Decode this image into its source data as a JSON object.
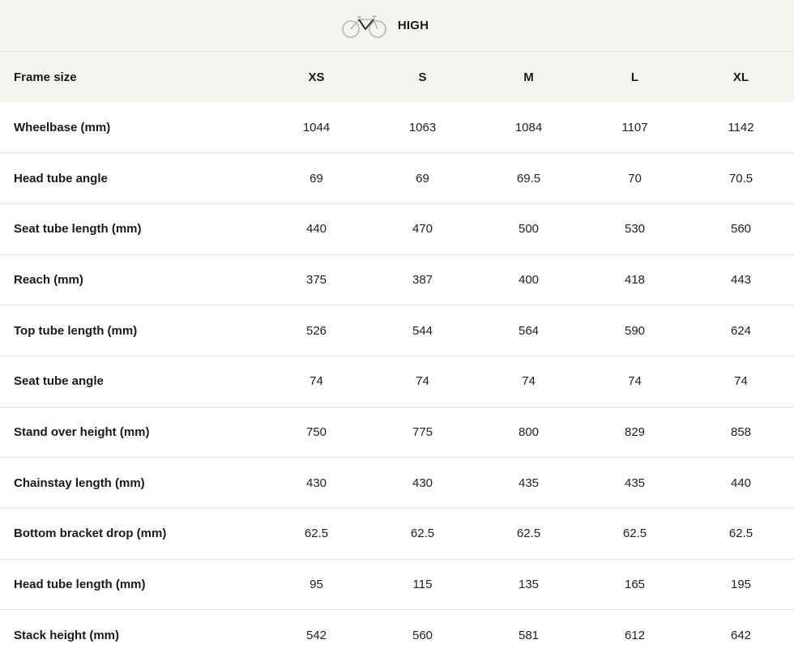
{
  "header": {
    "variant_label": "HIGH",
    "icon": "road-bike-icon"
  },
  "table": {
    "columns": {
      "label": "Frame size",
      "sizes": [
        "XS",
        "S",
        "M",
        "L",
        "XL"
      ]
    },
    "rows": [
      {
        "label": "Wheelbase (mm)",
        "values": [
          "1044",
          "1063",
          "1084",
          "1107",
          "1142"
        ]
      },
      {
        "label": "Head tube angle",
        "values": [
          "69",
          "69",
          "69.5",
          "70",
          "70.5"
        ]
      },
      {
        "label": "Seat tube length (mm)",
        "values": [
          "440",
          "470",
          "500",
          "530",
          "560"
        ]
      },
      {
        "label": "Reach (mm)",
        "values": [
          "375",
          "387",
          "400",
          "418",
          "443"
        ]
      },
      {
        "label": "Top tube length (mm)",
        "values": [
          "526",
          "544",
          "564",
          "590",
          "624"
        ]
      },
      {
        "label": "Seat tube angle",
        "values": [
          "74",
          "74",
          "74",
          "74",
          "74"
        ]
      },
      {
        "label": "Stand over height (mm)",
        "values": [
          "750",
          "775",
          "800",
          "829",
          "858"
        ]
      },
      {
        "label": "Chainstay length (mm)",
        "values": [
          "430",
          "430",
          "435",
          "435",
          "440"
        ]
      },
      {
        "label": "Bottom bracket drop (mm)",
        "values": [
          "62.5",
          "62.5",
          "62.5",
          "62.5",
          "62.5"
        ]
      },
      {
        "label": "Head tube length (mm)",
        "values": [
          "95",
          "115",
          "135",
          "165",
          "195"
        ]
      },
      {
        "label": "Stack height (mm)",
        "values": [
          "542",
          "560",
          "581",
          "612",
          "642"
        ]
      }
    ]
  }
}
